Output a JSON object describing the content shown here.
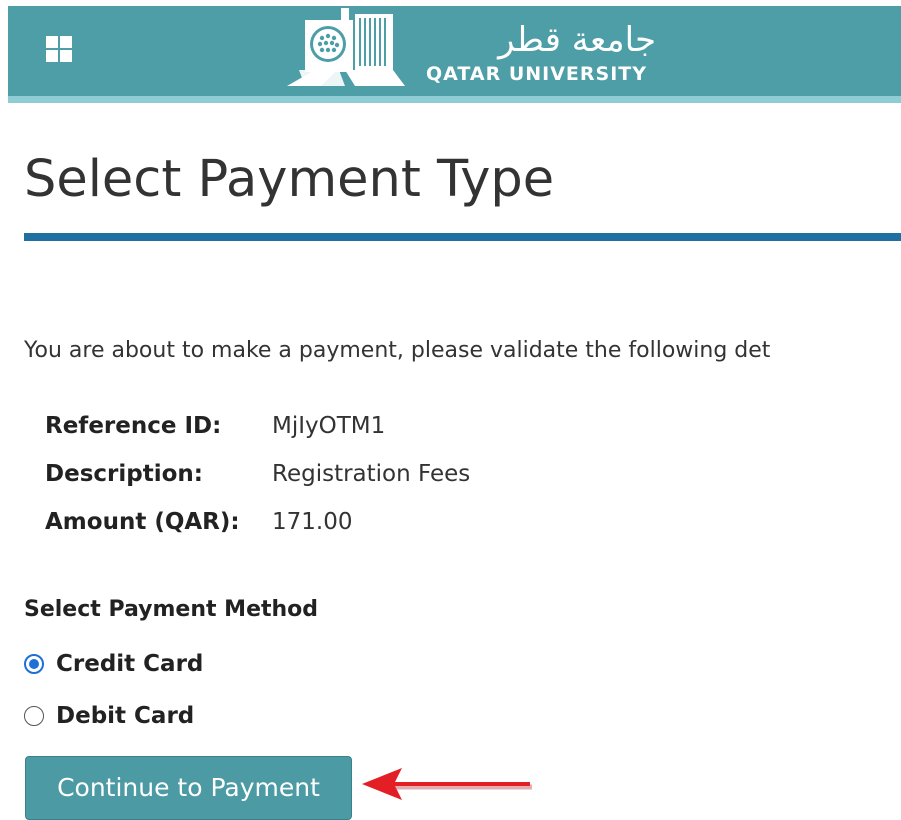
{
  "header": {
    "apps_icon": "apps-grid-icon",
    "logo_icon": "qatar-university-logo-icon",
    "logo_arabic": "جامعة قطر",
    "logo_english": "QATAR UNIVERSITY",
    "background": "#4d9ea7",
    "accent_border": "#8fcdd4"
  },
  "page": {
    "title": "Select Payment Type",
    "title_rule_color": "#1f6fa0",
    "intro": "You are about to make a payment, please validate the following det"
  },
  "details": [
    {
      "label": "Reference ID:",
      "value": "MjIyOTM1"
    },
    {
      "label": "Description:",
      "value": "Registration Fees"
    },
    {
      "label": "Amount (QAR):",
      "value": "171.00"
    }
  ],
  "payment_method": {
    "heading": "Select Payment Method",
    "options": [
      {
        "label": "Credit Card",
        "selected": true
      },
      {
        "label": "Debit Card",
        "selected": false
      }
    ]
  },
  "actions": {
    "continue_label": "Continue to Payment",
    "button_color": "#4b9aa4"
  },
  "annotation": {
    "arrow_icon": "red-arrow-left-icon",
    "arrow_color": "#e31e24"
  }
}
